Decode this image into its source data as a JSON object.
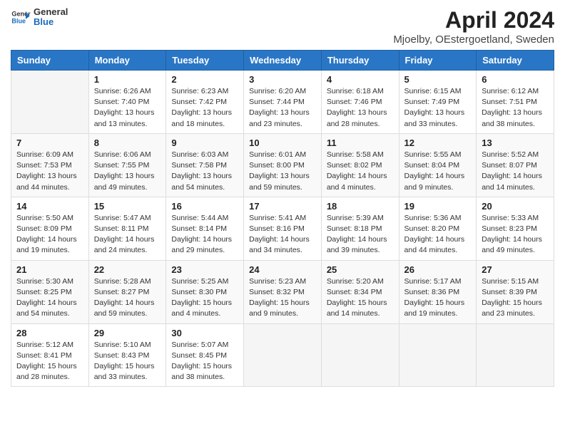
{
  "header": {
    "logo_general": "General",
    "logo_blue": "Blue",
    "title": "April 2024",
    "location": "Mjoelby, OEstergoetland, Sweden"
  },
  "calendar": {
    "days_of_week": [
      "Sunday",
      "Monday",
      "Tuesday",
      "Wednesday",
      "Thursday",
      "Friday",
      "Saturday"
    ],
    "weeks": [
      [
        {
          "day": "",
          "info": ""
        },
        {
          "day": "1",
          "info": "Sunrise: 6:26 AM\nSunset: 7:40 PM\nDaylight: 13 hours\nand 13 minutes."
        },
        {
          "day": "2",
          "info": "Sunrise: 6:23 AM\nSunset: 7:42 PM\nDaylight: 13 hours\nand 18 minutes."
        },
        {
          "day": "3",
          "info": "Sunrise: 6:20 AM\nSunset: 7:44 PM\nDaylight: 13 hours\nand 23 minutes."
        },
        {
          "day": "4",
          "info": "Sunrise: 6:18 AM\nSunset: 7:46 PM\nDaylight: 13 hours\nand 28 minutes."
        },
        {
          "day": "5",
          "info": "Sunrise: 6:15 AM\nSunset: 7:49 PM\nDaylight: 13 hours\nand 33 minutes."
        },
        {
          "day": "6",
          "info": "Sunrise: 6:12 AM\nSunset: 7:51 PM\nDaylight: 13 hours\nand 38 minutes."
        }
      ],
      [
        {
          "day": "7",
          "info": "Sunrise: 6:09 AM\nSunset: 7:53 PM\nDaylight: 13 hours\nand 44 minutes."
        },
        {
          "day": "8",
          "info": "Sunrise: 6:06 AM\nSunset: 7:55 PM\nDaylight: 13 hours\nand 49 minutes."
        },
        {
          "day": "9",
          "info": "Sunrise: 6:03 AM\nSunset: 7:58 PM\nDaylight: 13 hours\nand 54 minutes."
        },
        {
          "day": "10",
          "info": "Sunrise: 6:01 AM\nSunset: 8:00 PM\nDaylight: 13 hours\nand 59 minutes."
        },
        {
          "day": "11",
          "info": "Sunrise: 5:58 AM\nSunset: 8:02 PM\nDaylight: 14 hours\nand 4 minutes."
        },
        {
          "day": "12",
          "info": "Sunrise: 5:55 AM\nSunset: 8:04 PM\nDaylight: 14 hours\nand 9 minutes."
        },
        {
          "day": "13",
          "info": "Sunrise: 5:52 AM\nSunset: 8:07 PM\nDaylight: 14 hours\nand 14 minutes."
        }
      ],
      [
        {
          "day": "14",
          "info": "Sunrise: 5:50 AM\nSunset: 8:09 PM\nDaylight: 14 hours\nand 19 minutes."
        },
        {
          "day": "15",
          "info": "Sunrise: 5:47 AM\nSunset: 8:11 PM\nDaylight: 14 hours\nand 24 minutes."
        },
        {
          "day": "16",
          "info": "Sunrise: 5:44 AM\nSunset: 8:14 PM\nDaylight: 14 hours\nand 29 minutes."
        },
        {
          "day": "17",
          "info": "Sunrise: 5:41 AM\nSunset: 8:16 PM\nDaylight: 14 hours\nand 34 minutes."
        },
        {
          "day": "18",
          "info": "Sunrise: 5:39 AM\nSunset: 8:18 PM\nDaylight: 14 hours\nand 39 minutes."
        },
        {
          "day": "19",
          "info": "Sunrise: 5:36 AM\nSunset: 8:20 PM\nDaylight: 14 hours\nand 44 minutes."
        },
        {
          "day": "20",
          "info": "Sunrise: 5:33 AM\nSunset: 8:23 PM\nDaylight: 14 hours\nand 49 minutes."
        }
      ],
      [
        {
          "day": "21",
          "info": "Sunrise: 5:30 AM\nSunset: 8:25 PM\nDaylight: 14 hours\nand 54 minutes."
        },
        {
          "day": "22",
          "info": "Sunrise: 5:28 AM\nSunset: 8:27 PM\nDaylight: 14 hours\nand 59 minutes."
        },
        {
          "day": "23",
          "info": "Sunrise: 5:25 AM\nSunset: 8:30 PM\nDaylight: 15 hours\nand 4 minutes."
        },
        {
          "day": "24",
          "info": "Sunrise: 5:23 AM\nSunset: 8:32 PM\nDaylight: 15 hours\nand 9 minutes."
        },
        {
          "day": "25",
          "info": "Sunrise: 5:20 AM\nSunset: 8:34 PM\nDaylight: 15 hours\nand 14 minutes."
        },
        {
          "day": "26",
          "info": "Sunrise: 5:17 AM\nSunset: 8:36 PM\nDaylight: 15 hours\nand 19 minutes."
        },
        {
          "day": "27",
          "info": "Sunrise: 5:15 AM\nSunset: 8:39 PM\nDaylight: 15 hours\nand 23 minutes."
        }
      ],
      [
        {
          "day": "28",
          "info": "Sunrise: 5:12 AM\nSunset: 8:41 PM\nDaylight: 15 hours\nand 28 minutes."
        },
        {
          "day": "29",
          "info": "Sunrise: 5:10 AM\nSunset: 8:43 PM\nDaylight: 15 hours\nand 33 minutes."
        },
        {
          "day": "30",
          "info": "Sunrise: 5:07 AM\nSunset: 8:45 PM\nDaylight: 15 hours\nand 38 minutes."
        },
        {
          "day": "",
          "info": ""
        },
        {
          "day": "",
          "info": ""
        },
        {
          "day": "",
          "info": ""
        },
        {
          "day": "",
          "info": ""
        }
      ]
    ]
  }
}
